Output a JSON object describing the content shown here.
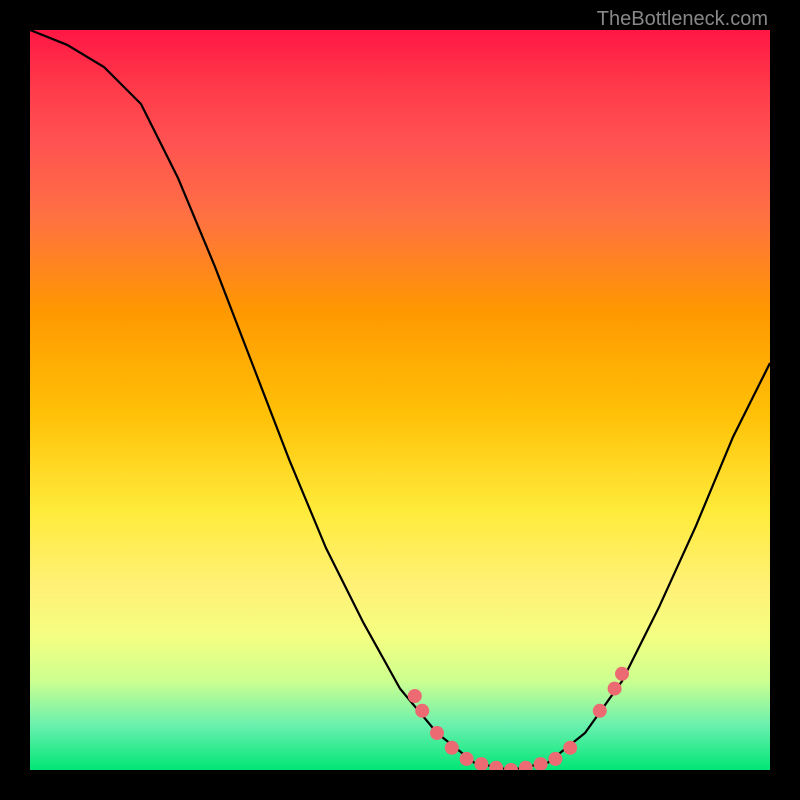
{
  "watermark": "TheBottleneck.com",
  "chart_data": {
    "type": "line",
    "title": "",
    "xlabel": "",
    "ylabel": "",
    "xlim": [
      0,
      100
    ],
    "ylim": [
      0,
      100
    ],
    "curve": [
      {
        "x": 0,
        "y": 100
      },
      {
        "x": 5,
        "y": 98
      },
      {
        "x": 10,
        "y": 95
      },
      {
        "x": 15,
        "y": 90
      },
      {
        "x": 20,
        "y": 80
      },
      {
        "x": 25,
        "y": 68
      },
      {
        "x": 30,
        "y": 55
      },
      {
        "x": 35,
        "y": 42
      },
      {
        "x": 40,
        "y": 30
      },
      {
        "x": 45,
        "y": 20
      },
      {
        "x": 50,
        "y": 11
      },
      {
        "x": 55,
        "y": 5
      },
      {
        "x": 60,
        "y": 1
      },
      {
        "x": 65,
        "y": 0
      },
      {
        "x": 70,
        "y": 1
      },
      {
        "x": 75,
        "y": 5
      },
      {
        "x": 80,
        "y": 12
      },
      {
        "x": 85,
        "y": 22
      },
      {
        "x": 90,
        "y": 33
      },
      {
        "x": 95,
        "y": 45
      },
      {
        "x": 100,
        "y": 55
      }
    ],
    "markers": [
      {
        "x": 52,
        "y": 10
      },
      {
        "x": 53,
        "y": 8
      },
      {
        "x": 55,
        "y": 5
      },
      {
        "x": 57,
        "y": 3
      },
      {
        "x": 59,
        "y": 1.5
      },
      {
        "x": 61,
        "y": 0.8
      },
      {
        "x": 63,
        "y": 0.3
      },
      {
        "x": 65,
        "y": 0
      },
      {
        "x": 67,
        "y": 0.3
      },
      {
        "x": 69,
        "y": 0.8
      },
      {
        "x": 71,
        "y": 1.5
      },
      {
        "x": 73,
        "y": 3
      },
      {
        "x": 77,
        "y": 8
      },
      {
        "x": 79,
        "y": 11
      },
      {
        "x": 80,
        "y": 13
      }
    ],
    "marker_color": "#ec6b72",
    "line_color": "#000000"
  }
}
